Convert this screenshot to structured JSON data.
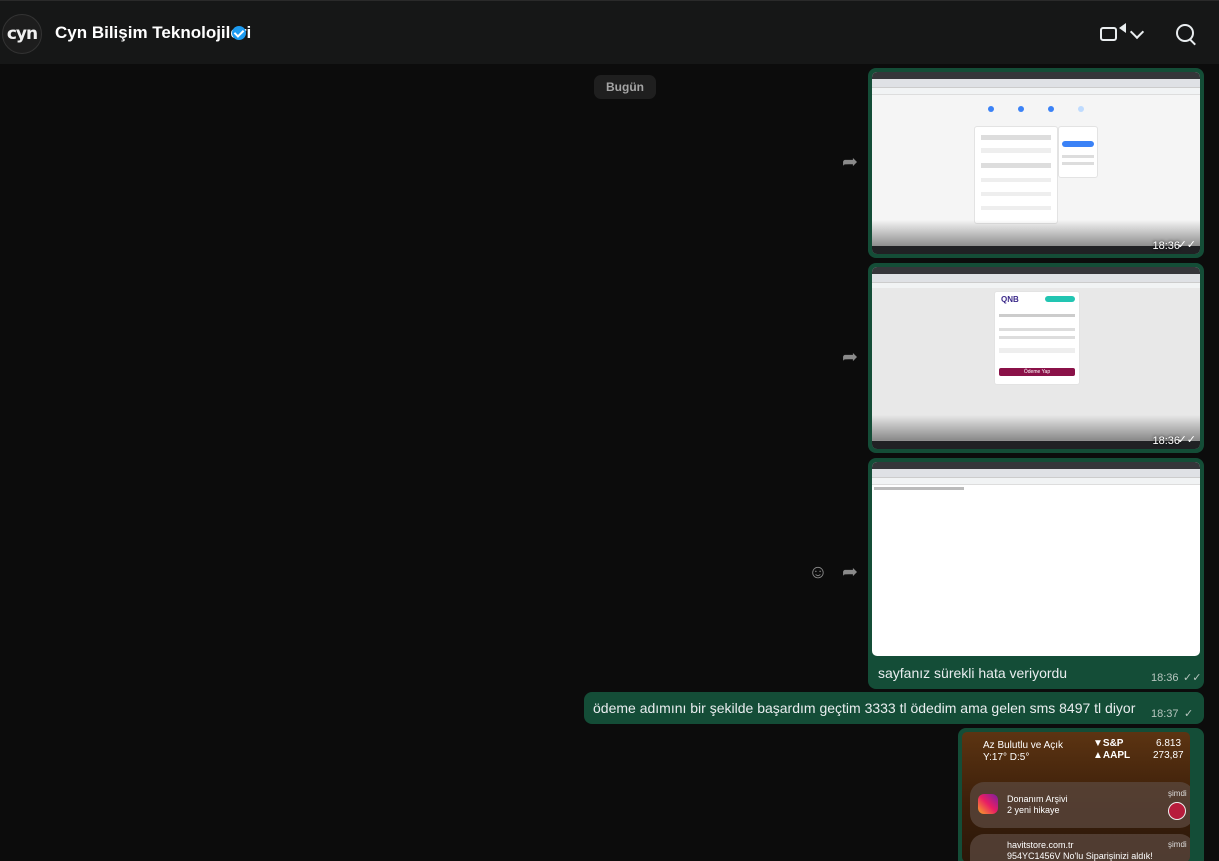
{
  "header": {
    "avatar_text": "cyn",
    "title": "Cyn Bilişim Teknolojileri",
    "verified_icon": "verified-badge-icon",
    "video_call_icon": "video-camera-icon",
    "video_menu_icon": "chevron-down-icon",
    "search_icon": "search-icon"
  },
  "chat": {
    "day_separator": "Bugün",
    "messages": [
      {
        "type": "image",
        "time": "18:36",
        "status": "read"
      },
      {
        "type": "image",
        "time": "18:36",
        "status": "read"
      },
      {
        "type": "image",
        "caption": "sayfanız sürekli hata veriyordu",
        "time": "18:36",
        "status": "read"
      },
      {
        "type": "text",
        "text": "ödeme adımını bir şekilde başardım geçtim 3333 tl ödedim ama gelen sms 8497 tl diyor",
        "time": "18:37",
        "status": "sent"
      },
      {
        "type": "image"
      }
    ]
  },
  "screenshot2": {
    "bank_logo": "QNB",
    "button": "Ödeme Yap"
  },
  "phone_screenshot": {
    "weather": "Az Bulutlu ve Açık",
    "temps": "Y:17° D:5°",
    "stocks": [
      {
        "symbol": "▼S&P",
        "value": "6.813"
      },
      {
        "symbol": "▲AAPL",
        "value": "273,87"
      }
    ],
    "notifications": [
      {
        "app": "Donanım Arşivi",
        "body": "2 yeni hikaye",
        "when": "şimdi"
      },
      {
        "app": "havitstore.com.tr",
        "body": "954YC1456V No'lu Siparişinizi aldık!",
        "when": "şimdi"
      }
    ]
  },
  "icons": {
    "forward": "forward-icon",
    "emoji": "emoji-icon",
    "double_tick": "double-check-icon",
    "single_tick": "single-check-icon"
  }
}
